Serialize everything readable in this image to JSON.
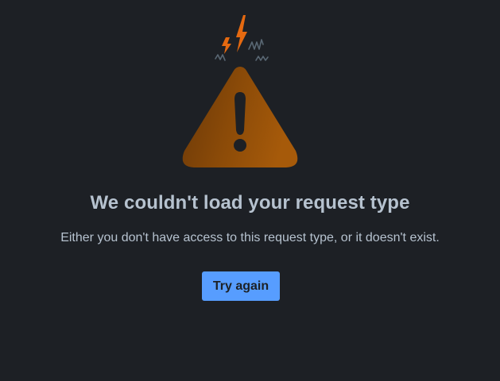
{
  "error": {
    "title": "We couldn't load your request type",
    "message": "Either you don't have access to this request type, or it doesn't exist.",
    "retry_label": "Try again",
    "illustration_icon": "warning-triangle-icon"
  },
  "colors": {
    "background": "#1d2025",
    "text": "#b6c2cf",
    "button": "#579dff",
    "button_text": "#1d2125",
    "warning_dark": "#6e3a08",
    "warning_light": "#a15809",
    "spark_orange": "#e56910",
    "squiggle_gray": "#596773"
  }
}
